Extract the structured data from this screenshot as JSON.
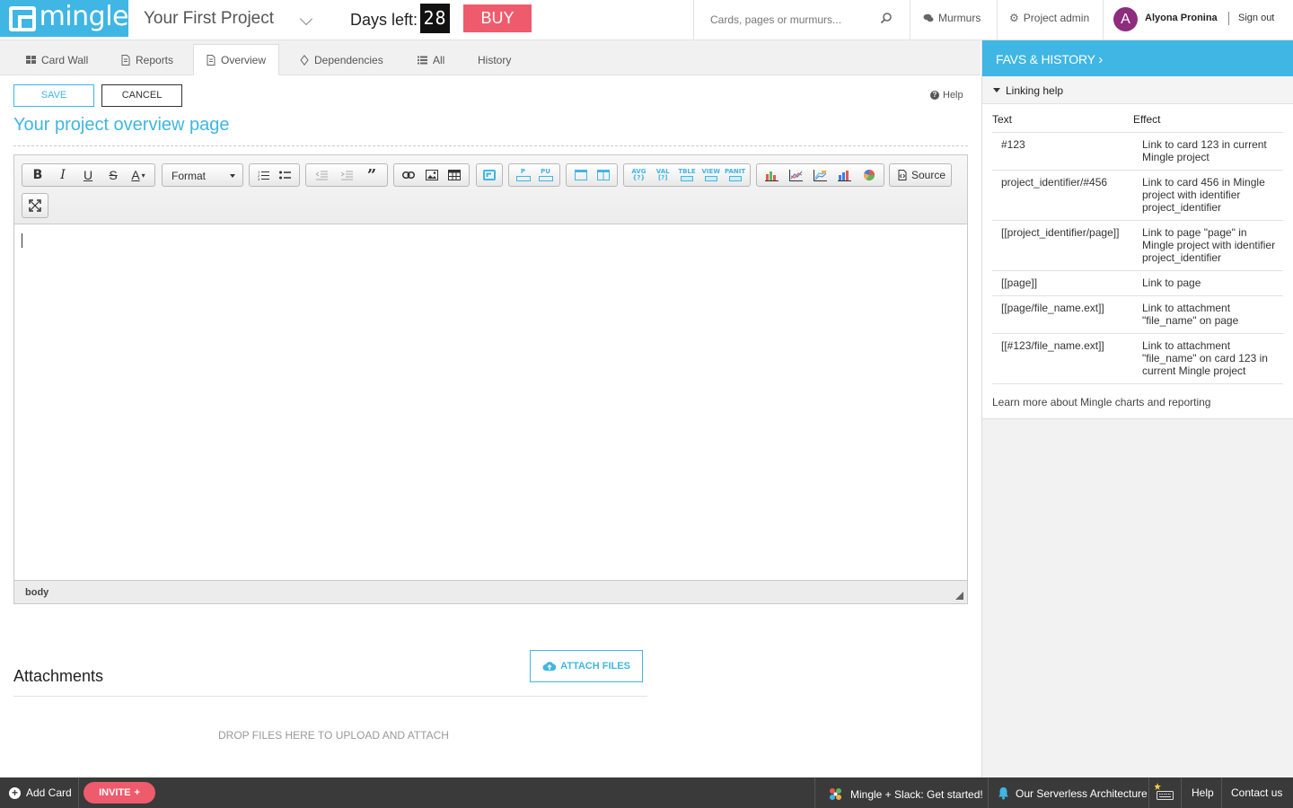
{
  "header": {
    "logo_text": "mingle",
    "project_name": "Your First Project",
    "days_left_label": "Days left:",
    "days_left_value": "28",
    "buy_label": "BUY",
    "search_placeholder": "Cards, pages or murmurs...",
    "murmurs_label": "Murmurs",
    "project_admin_label": "Project admin",
    "avatar_initial": "A",
    "user_name": "Alyona Pronina",
    "sign_out_label": "Sign out"
  },
  "tabs": [
    {
      "label": "Card Wall",
      "icon": "grid-icon"
    },
    {
      "label": "Reports",
      "icon": "document-icon"
    },
    {
      "label": "Overview",
      "icon": "page-icon",
      "active": true
    },
    {
      "label": "Dependencies",
      "icon": "diamond-icon"
    },
    {
      "label": "All",
      "icon": "list-icon"
    },
    {
      "label": "History",
      "icon": ""
    }
  ],
  "editor": {
    "save_label": "SAVE",
    "cancel_label": "CANCEL",
    "help_label": "Help",
    "page_title": "Your project overview page",
    "format_label": "Format",
    "source_label": "Source",
    "status_path": "body",
    "macro_labels": [
      "AVG",
      "VAL",
      "TBLE",
      "VIEW",
      "PANIT"
    ],
    "p_labels": [
      "P",
      "PU"
    ]
  },
  "sidebar": {
    "header": "FAVS & HISTORY",
    "panel_title": "Linking help",
    "col_text": "Text",
    "col_effect": "Effect",
    "rows": [
      {
        "text": "#123",
        "effect": "Link to card 123 in current Mingle project"
      },
      {
        "text": "project_identifier/#456",
        "effect": "Link to card 456 in Mingle project with identifier project_identifier"
      },
      {
        "text": "[[project_identifier/page]]",
        "effect": "Link to page \"page\" in Mingle project with identifier project_identifier"
      },
      {
        "text": "[[page]]",
        "effect": "Link to page"
      },
      {
        "text": "[[page/file_name.ext]]",
        "effect": "Link to attachment \"file_name\" on page"
      },
      {
        "text": "[[#123/file_name.ext]]",
        "effect": "Link to attachment \"file_name\" on card 123 in current Mingle project"
      }
    ],
    "learn_more": "Learn more about Mingle charts and reporting"
  },
  "attachments": {
    "title": "Attachments",
    "attach_label": "ATTACH FILES",
    "drop_label": "DROP FILES HERE TO UPLOAD AND ATTACH"
  },
  "bottombar": {
    "add_card_label": "Add Card",
    "invite_label": "INVITE",
    "slack_label": "Mingle + Slack: Get started!",
    "serverless_label": "Our Serverless Architecture",
    "help_label": "Help",
    "contact_label": "Contact us"
  },
  "colors": {
    "brand": "#3fb6e4",
    "buy": "#ee5b6d",
    "avatar": "#8e2c7d",
    "bottombar": "#3a3a3a"
  }
}
